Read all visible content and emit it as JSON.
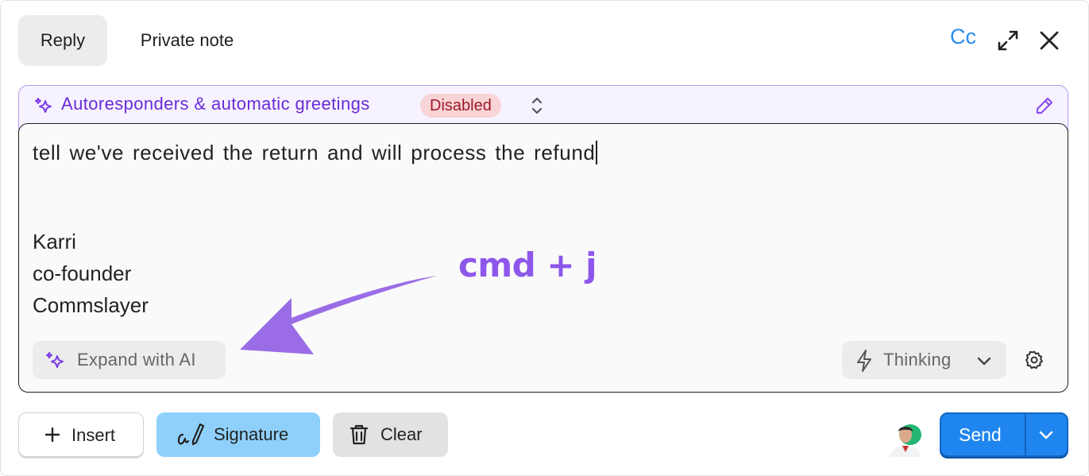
{
  "tabs": {
    "reply": "Reply",
    "private_note": "Private note"
  },
  "header": {
    "cc": "Cc",
    "expand_icon": "expand-icon",
    "close_icon": "close-icon"
  },
  "autoresponder": {
    "label": "Autoresponders & automatic greetings",
    "status": "Disabled",
    "accent": "#6a2bd8"
  },
  "editor": {
    "text": "tell we've received the return and will process the refund",
    "signature": [
      "Karri",
      "co-founder",
      "Commslayer"
    ]
  },
  "annotation": {
    "shortcut": "cmd + j",
    "color": "#8e57ec"
  },
  "ai": {
    "expand_label": "Expand with AI",
    "mode_label": "Thinking"
  },
  "toolbar": {
    "insert": "Insert",
    "signature": "Signature",
    "clear": "Clear",
    "send": "Send"
  },
  "colors": {
    "send": "#1f86ef",
    "signature_bg": "#8fd0fb",
    "cc": "#2a8cf0"
  }
}
